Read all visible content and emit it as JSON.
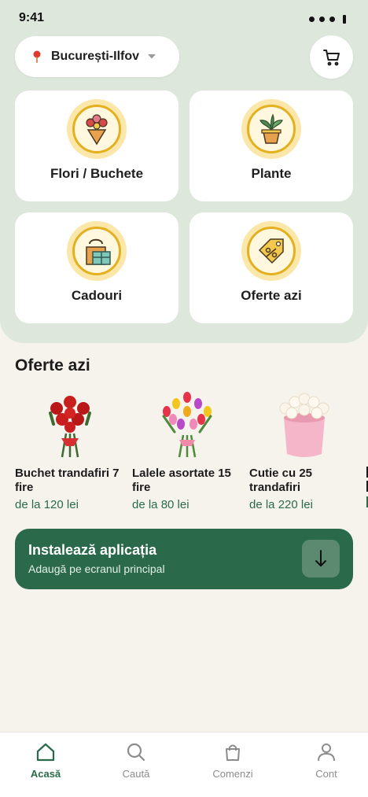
{
  "status_bar": {
    "time": "9:41"
  },
  "header": {
    "location": "București-Ilfov",
    "location_icon": "pin-icon",
    "cart_icon": "cart-icon"
  },
  "categories": [
    {
      "label": "Flori / Buchete",
      "icon": "flowers-icon"
    },
    {
      "label": "Plante",
      "icon": "plant-icon"
    },
    {
      "label": "Cadouri",
      "icon": "gift-icon"
    },
    {
      "label": "Oferte azi",
      "icon": "tag-icon"
    }
  ],
  "offers": {
    "title": "Oferte azi",
    "products": [
      {
        "title": "Buchet trandafiri 7 fire",
        "price": "de la 120 lei"
      },
      {
        "title": "Lalele asortate 15 fire",
        "price": "de la 80 lei"
      },
      {
        "title": "Cutie cu 25 trandafiri",
        "price": "de la 220 lei"
      }
    ]
  },
  "install_banner": {
    "title": "Instalează aplicația",
    "subtitle": "Adaugă pe ecranul principal",
    "icon": "download-arrow-icon"
  },
  "bottom_nav": [
    {
      "label": "Acasă",
      "icon": "home-icon",
      "active": true
    },
    {
      "label": "Caută",
      "icon": "search-icon",
      "active": false
    },
    {
      "label": "Comenzi",
      "icon": "bag-icon",
      "active": false
    },
    {
      "label": "Cont",
      "icon": "person-icon",
      "active": false
    }
  ],
  "colors": {
    "primary_green": "#2a6a4a",
    "mint_background": "#dde7dc",
    "cream_background": "#f6f3ec",
    "illustration_yellow": "#e3b020"
  }
}
